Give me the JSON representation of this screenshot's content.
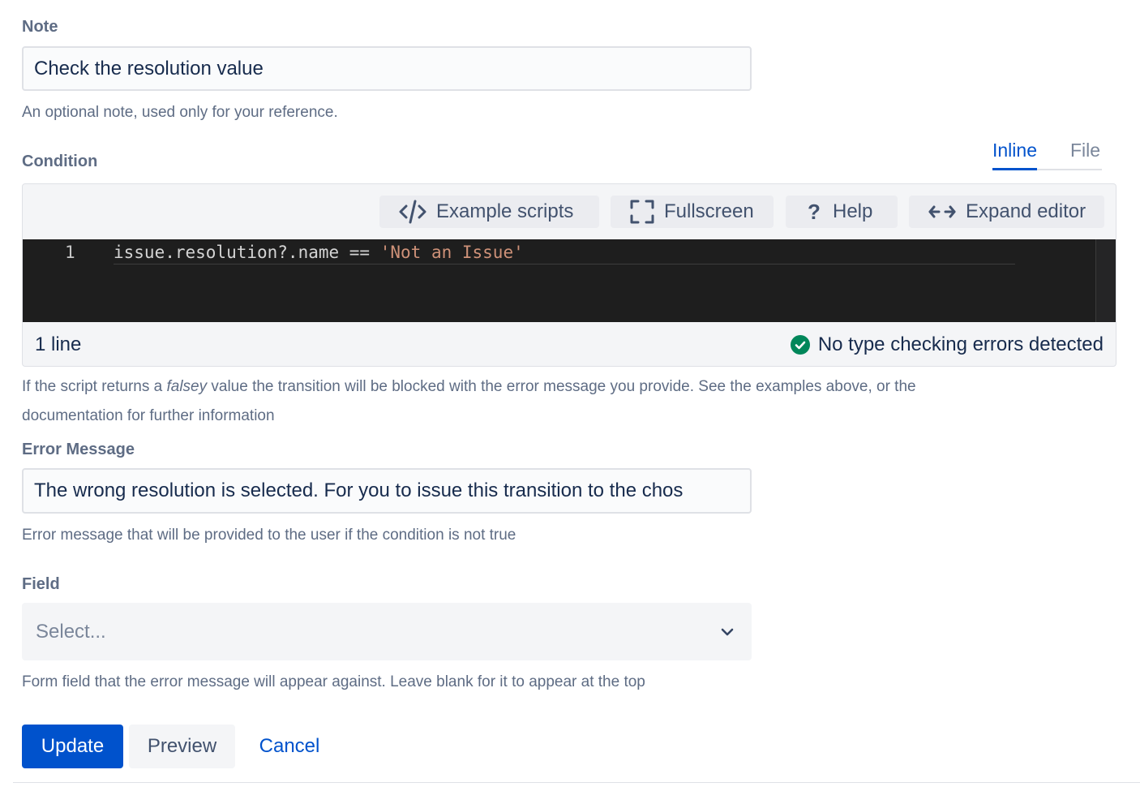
{
  "note": {
    "label": "Note",
    "value": "Check the resolution value",
    "help": "An optional note, used only for your reference."
  },
  "condition": {
    "label": "Condition",
    "tabs": [
      {
        "label": "Inline",
        "active": true
      },
      {
        "label": "File",
        "active": false
      }
    ],
    "toolbar": {
      "example_scripts": "Example scripts",
      "fullscreen": "Fullscreen",
      "help": "Help",
      "expand_editor": "Expand editor"
    },
    "code": {
      "line_number": "1",
      "code_part": "issue.resolution?.name ==",
      "string_part": "'Not an Issue'"
    },
    "status": {
      "line_count": "1 line",
      "message": "No type checking errors detected"
    },
    "help_before": "If the script returns a ",
    "help_em": "falsey",
    "help_after": " value the transition will be blocked with the error message you provide. See the examples above, or the",
    "help_line2": "documentation for further information"
  },
  "error_message": {
    "label": "Error Message",
    "value": "The wrong resolution is selected. For you to issue this transition to the chos",
    "help": "Error message that will be provided to the user if the condition is not true"
  },
  "field": {
    "label": "Field",
    "placeholder": "Select...",
    "help": "Form field that the error message will appear against. Leave blank for it to appear at the top"
  },
  "actions": {
    "update": "Update",
    "preview": "Preview",
    "cancel": "Cancel"
  },
  "colors": {
    "primary": "#0052cc",
    "success": "#00875a",
    "code_bg": "#1e1e1e",
    "code_string": "#ce9178"
  },
  "icons": {
    "example_scripts": "code-icon",
    "fullscreen": "fullscreen-icon",
    "help": "question-icon",
    "expand": "expand-arrows-icon",
    "status": "check-circle-icon",
    "select": "chevron-down-icon"
  }
}
